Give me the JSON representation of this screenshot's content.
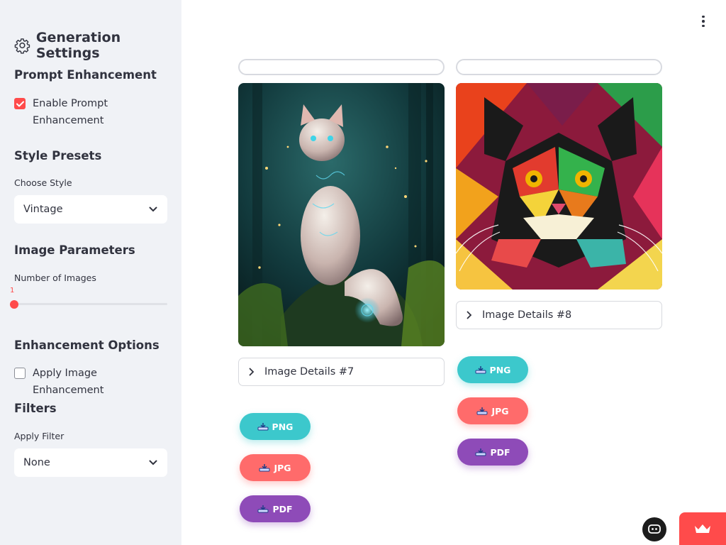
{
  "sidebar": {
    "title": "Generation Settings",
    "prompt_enhancement": {
      "heading": "Prompt Enhancement",
      "checkbox_label": "Enable Prompt Enhancement",
      "checked": true
    },
    "style_presets": {
      "heading": "Style Presets",
      "label": "Choose Style",
      "selected": "Vintage"
    },
    "image_parameters": {
      "heading": "Image Parameters",
      "label": "Number of Images",
      "slider_value": "1"
    },
    "enhancement_options": {
      "heading": "Enhancement Options",
      "checkbox_label": "Apply Image Enhancement",
      "checked": false
    },
    "filters": {
      "heading": "Filters",
      "label": "Apply Filter",
      "selected": "None"
    }
  },
  "gallery": [
    {
      "details_label": "Image Details #7",
      "image_description": "mystical white cat with glowing blue markings in a forest",
      "buttons": {
        "png": "PNG",
        "jpg": "JPG",
        "pdf": "PDF"
      }
    },
    {
      "details_label": "Image Details #8",
      "image_description": "colorful geometric low-poly cat portrait",
      "buttons": {
        "png": "PNG",
        "jpg": "JPG",
        "pdf": "PDF"
      }
    }
  ],
  "colors": {
    "accent": "#ff4b4b",
    "png_button": "#3cc8cc",
    "jpg_button": "#ff6b6b",
    "pdf_button": "#8e4bb8",
    "sidebar_bg": "#f0f2f6"
  }
}
